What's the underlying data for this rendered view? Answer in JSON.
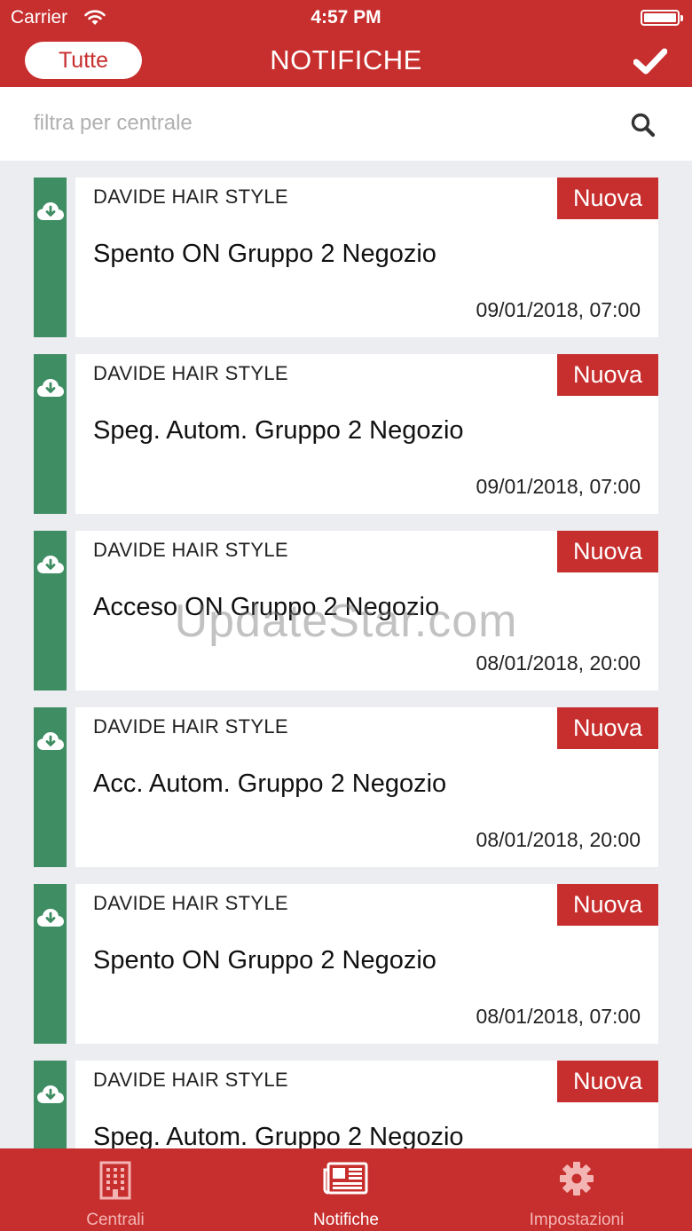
{
  "status_bar": {
    "carrier": "Carrier",
    "time": "4:57 PM"
  },
  "nav": {
    "filter_label": "Tutte",
    "title": "NOTIFICHE",
    "confirm_icon": "check-icon"
  },
  "search": {
    "placeholder": "filtra per centrale",
    "icon": "search-icon"
  },
  "notifications": [
    {
      "client": "DAVIDE HAIR STYLE",
      "badge": "Nuova",
      "message": "Spento ON Gruppo 2 Negozio",
      "timestamp": "09/01/2018, 07:00",
      "icon": "cloud-download-icon"
    },
    {
      "client": "DAVIDE HAIR STYLE",
      "badge": "Nuova",
      "message": "Speg. Autom. Gruppo 2 Negozio",
      "timestamp": "09/01/2018, 07:00",
      "icon": "cloud-download-icon"
    },
    {
      "client": "DAVIDE HAIR STYLE",
      "badge": "Nuova",
      "message": "Acceso ON Gruppo 2 Negozio",
      "timestamp": "08/01/2018, 20:00",
      "icon": "cloud-download-icon"
    },
    {
      "client": "DAVIDE HAIR STYLE",
      "badge": "Nuova",
      "message": "Acc. Autom. Gruppo 2 Negozio",
      "timestamp": "08/01/2018, 20:00",
      "icon": "cloud-download-icon"
    },
    {
      "client": "DAVIDE HAIR STYLE",
      "badge": "Nuova",
      "message": "Spento ON Gruppo 2 Negozio",
      "timestamp": "08/01/2018, 07:00",
      "icon": "cloud-download-icon"
    },
    {
      "client": "DAVIDE HAIR STYLE",
      "badge": "Nuova",
      "message": "Speg. Autom. Gruppo 2 Negozio",
      "timestamp": "",
      "icon": "cloud-download-icon"
    }
  ],
  "watermark": "UpdateStar.com",
  "tabbar": {
    "tabs": [
      {
        "label": "Centrali",
        "icon": "building-icon",
        "active": false
      },
      {
        "label": "Notifiche",
        "icon": "newspaper-icon",
        "active": true
      },
      {
        "label": "Impostazioni",
        "icon": "gear-icon",
        "active": false
      }
    ]
  },
  "colors": {
    "primary_red": "#c72f2e",
    "stripe_green": "#3e8d63",
    "background": "#ecedf1",
    "tab_inactive": "#f3b5b4"
  }
}
